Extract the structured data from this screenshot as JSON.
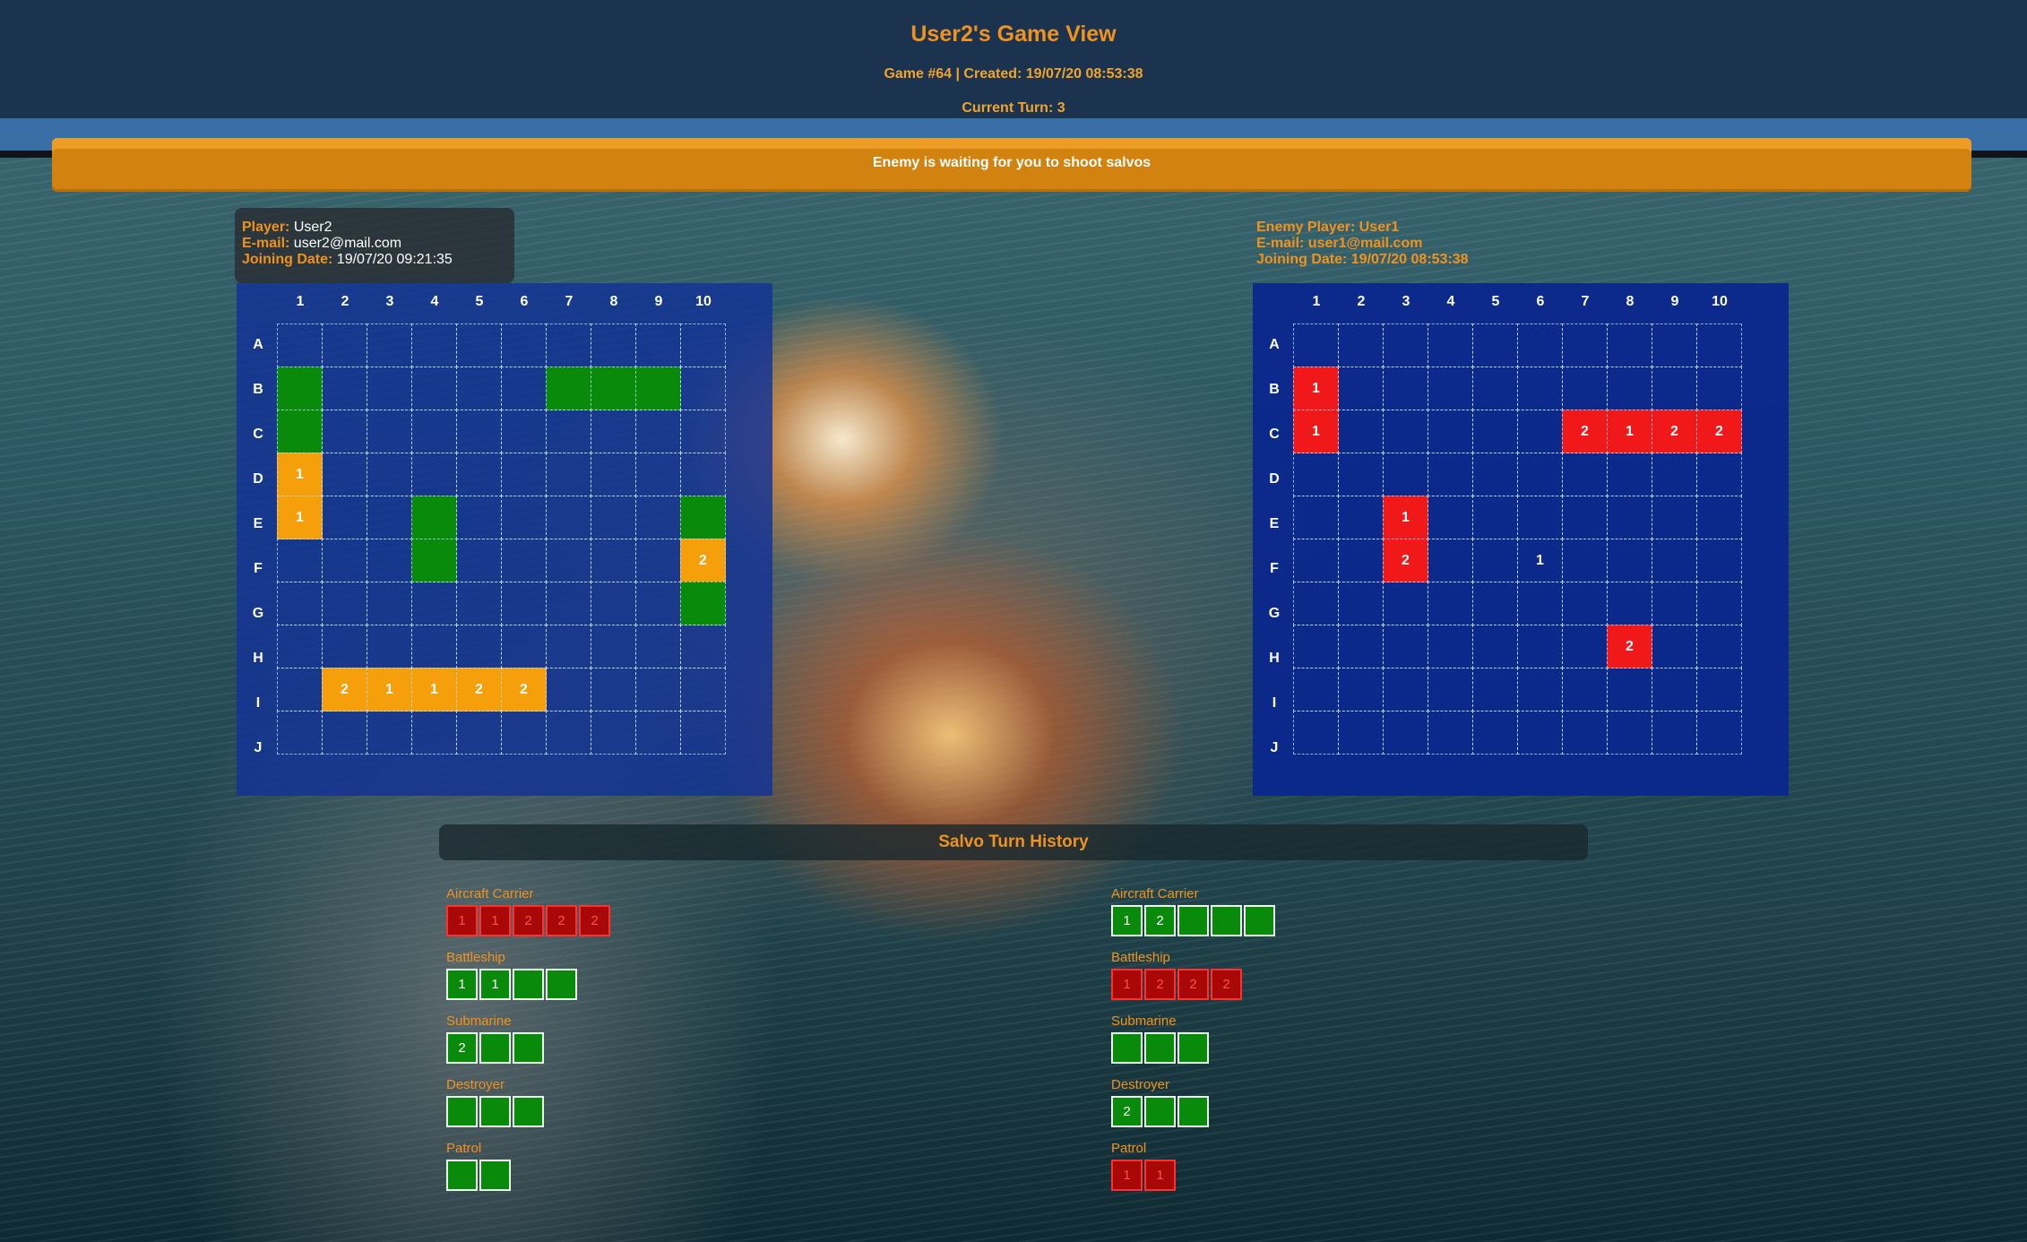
{
  "header": {
    "title": "User2's Game View",
    "subtitle": "Game #64 | Created: 19/07/20 08:53:38",
    "turn": "Current Turn: 3"
  },
  "banner": {
    "text": "Enemy is waiting for you to shoot salvos"
  },
  "player": {
    "label_player": "Player:",
    "name": "User2",
    "label_email": "E-mail:",
    "email": "user2@mail.com",
    "label_joined": "Joining Date:",
    "joined": "19/07/20 09:21:35"
  },
  "enemy": {
    "label_player": "Enemy Player:",
    "name": "User1",
    "label_email": "E-mail:",
    "email": "user1@mail.com",
    "label_joined": "Joining Date:",
    "joined": "19/07/20 08:53:38"
  },
  "grid": {
    "columns": [
      "1",
      "2",
      "3",
      "4",
      "5",
      "6",
      "7",
      "8",
      "9",
      "10"
    ],
    "rows": [
      "A",
      "B",
      "C",
      "D",
      "E",
      "F",
      "G",
      "H",
      "I",
      "J"
    ]
  },
  "player_board": {
    "ships": [
      "B1",
      "C1",
      "B7",
      "B8",
      "B9",
      "E4",
      "F4",
      "E10",
      "G10"
    ],
    "hits": [
      {
        "cell": "D1",
        "turn": "1"
      },
      {
        "cell": "E1",
        "turn": "1"
      },
      {
        "cell": "F10",
        "turn": "2"
      },
      {
        "cell": "I2",
        "turn": "2"
      },
      {
        "cell": "I3",
        "turn": "1"
      },
      {
        "cell": "I4",
        "turn": "1"
      },
      {
        "cell": "I5",
        "turn": "2"
      },
      {
        "cell": "I6",
        "turn": "2"
      }
    ],
    "colors": {
      "ship": "#0a8a0a",
      "hit": "#f5a00a"
    }
  },
  "enemy_board": {
    "hits": [
      {
        "cell": "B1",
        "turn": "1"
      },
      {
        "cell": "C1",
        "turn": "1"
      },
      {
        "cell": "C7",
        "turn": "2"
      },
      {
        "cell": "C8",
        "turn": "1"
      },
      {
        "cell": "C9",
        "turn": "2"
      },
      {
        "cell": "C10",
        "turn": "2"
      },
      {
        "cell": "E3",
        "turn": "1"
      },
      {
        "cell": "F3",
        "turn": "2"
      },
      {
        "cell": "H8",
        "turn": "2"
      }
    ],
    "misses": [
      {
        "cell": "F6",
        "turn": "1"
      }
    ],
    "colors": {
      "hit": "#f01818"
    }
  },
  "history": {
    "title": "Salvo Turn History",
    "player_ships": [
      {
        "name": "Aircraft Carrier",
        "cells": [
          "1",
          "1",
          "2",
          "2",
          "2"
        ],
        "state": "sunk"
      },
      {
        "name": "Battleship",
        "cells": [
          "1",
          "1",
          "",
          ""
        ],
        "state": "afloat"
      },
      {
        "name": "Submarine",
        "cells": [
          "2",
          "",
          ""
        ],
        "state": "afloat"
      },
      {
        "name": "Destroyer",
        "cells": [
          "",
          "",
          ""
        ],
        "state": "afloat"
      },
      {
        "name": "Patrol Boat",
        "cells": [
          "",
          ""
        ],
        "state": "afloat"
      }
    ],
    "enemy_ships": [
      {
        "name": "Aircraft Carrier",
        "cells": [
          "1",
          "2",
          "",
          "",
          ""
        ],
        "state": "afloat"
      },
      {
        "name": "Battleship",
        "cells": [
          "1",
          "2",
          "2",
          "2"
        ],
        "state": "sunk"
      },
      {
        "name": "Submarine",
        "cells": [
          "",
          "",
          ""
        ],
        "state": "afloat"
      },
      {
        "name": "Destroyer",
        "cells": [
          "2",
          "",
          ""
        ],
        "state": "afloat"
      },
      {
        "name": "Patrol Boat",
        "cells": [
          "1",
          "1"
        ],
        "state": "sunk"
      }
    ]
  }
}
